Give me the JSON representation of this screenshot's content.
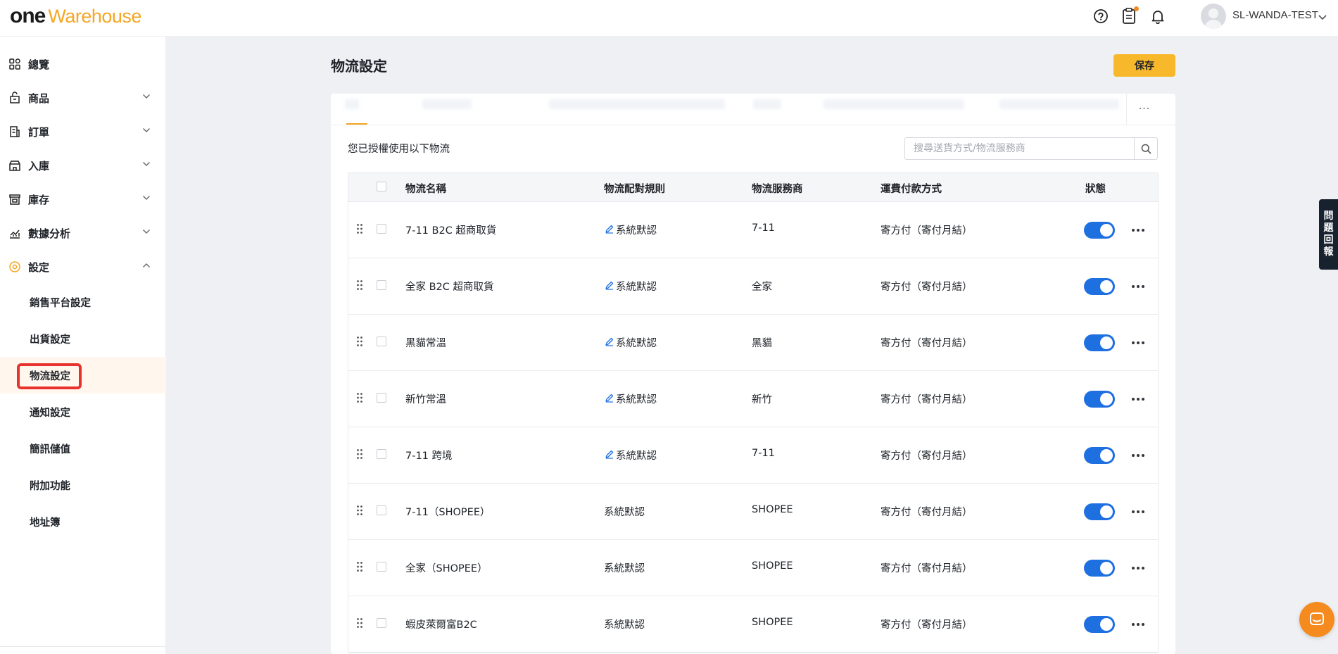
{
  "app": {
    "logo_one": "one",
    "logo_warehouse": "Warehouse",
    "brand_color": "#f5a623",
    "accent_color": "#1e6fe0",
    "highlight_color": "#e8322d"
  },
  "header": {
    "username": "SL-WANDA-TEST",
    "icons": [
      "help-icon",
      "clipboard-icon",
      "bell-icon",
      "avatar",
      "chevron-down-icon"
    ]
  },
  "sidebar": {
    "items": [
      {
        "label": "總覽",
        "icon": "overview-grid-icon"
      },
      {
        "label": "商品",
        "icon": "product-icon"
      },
      {
        "label": "訂單",
        "icon": "order-icon"
      },
      {
        "label": "入庫",
        "icon": "inbound-icon"
      },
      {
        "label": "庫存",
        "icon": "inventory-icon"
      },
      {
        "label": "數據分析",
        "icon": "analytics-icon"
      },
      {
        "label": "設定",
        "icon": "settings-icon"
      }
    ],
    "sub_items": [
      {
        "label": "銷售平台設定"
      },
      {
        "label": "出貨設定"
      },
      {
        "label": "物流設定"
      },
      {
        "label": "通知設定"
      },
      {
        "label": "簡訊儲值"
      },
      {
        "label": "附加功能"
      },
      {
        "label": "地址簿"
      }
    ]
  },
  "main": {
    "title": "物流設定",
    "save_label": "保存",
    "tab_more": "···",
    "authorized_text": "您已授權使用以下物流",
    "search": {
      "placeholder": "搜尋送貨方式/物流服務商",
      "value": ""
    },
    "table": {
      "headers": {
        "name": "物流名稱",
        "rule": "物流配對規則",
        "provider": "物流服務商",
        "payment": "運費付款方式",
        "status": "狀態"
      },
      "rows": [
        {
          "name": "7-11 B2C 超商取貨",
          "rule": "系統默認",
          "rule_editable": true,
          "provider": "7-11",
          "payment": "寄方付（寄付月結）",
          "enabled": true
        },
        {
          "name": "全家 B2C 超商取貨",
          "rule": "系統默認",
          "rule_editable": true,
          "provider": "全家",
          "payment": "寄方付（寄付月結）",
          "enabled": true
        },
        {
          "name": "黑貓常溫",
          "rule": "系統默認",
          "rule_editable": true,
          "provider": "黑貓",
          "payment": "寄方付（寄付月結）",
          "enabled": true
        },
        {
          "name": "新竹常溫",
          "rule": "系統默認",
          "rule_editable": true,
          "provider": "新竹",
          "payment": "寄方付（寄付月結）",
          "enabled": true
        },
        {
          "name": "7-11 跨境",
          "rule": "系統默認",
          "rule_editable": true,
          "provider": "7-11",
          "payment": "寄方付（寄付月結）",
          "enabled": true
        },
        {
          "name": "7-11（SHOPEE）",
          "rule": "系統默認",
          "rule_editable": false,
          "provider": "SHOPEE",
          "payment": "寄方付（寄付月結）",
          "enabled": true
        },
        {
          "name": "全家（SHOPEE）",
          "rule": "系統默認",
          "rule_editable": false,
          "provider": "SHOPEE",
          "payment": "寄方付（寄付月結）",
          "enabled": true
        },
        {
          "name": "蝦皮萊爾富B2C",
          "rule": "系統默認",
          "rule_editable": false,
          "provider": "SHOPEE",
          "payment": "寄方付（寄付月結）",
          "enabled": true
        }
      ]
    }
  },
  "floating": {
    "feedback_chars": [
      "問",
      "題",
      "回",
      "報"
    ]
  }
}
